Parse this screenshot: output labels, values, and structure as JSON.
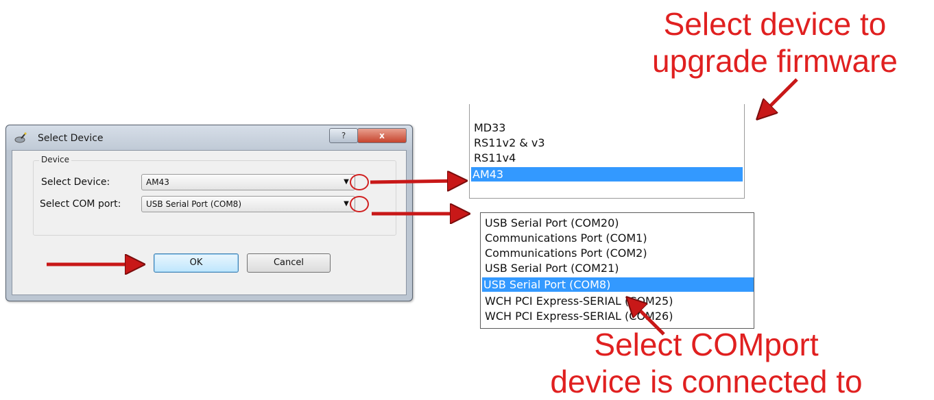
{
  "annotations": {
    "top_callout": [
      "Select device to",
      "upgrade firmware"
    ],
    "bottom_callout": [
      "Select COMport",
      "device is connected to"
    ],
    "accent_color": "#e02020"
  },
  "dialog": {
    "title": "Select Device",
    "title_icon": "app-icon",
    "help_button": "?",
    "close_button": "x",
    "group_label": "Device",
    "device_label": "Select Device:",
    "device_value": "AM43",
    "com_label": "Select COM port:",
    "com_value": "USB Serial Port (COM8)",
    "ok_label": "OK",
    "cancel_label": "Cancel"
  },
  "device_dropdown": {
    "items": [
      "MD33",
      "RS11v2 & v3",
      "RS11v4",
      "AM43"
    ],
    "selected": "AM43",
    "selection_color": "#3399ff"
  },
  "com_dropdown": {
    "items": [
      "USB Serial Port (COM20)",
      "Communications Port (COM1)",
      "Communications Port (COM2)",
      "USB Serial Port (COM21)",
      "USB Serial Port (COM8)",
      "WCH PCI Express-SERIAL (COM25)",
      "WCH PCI Express-SERIAL (COM26)"
    ],
    "selected": "USB Serial Port (COM8)"
  }
}
